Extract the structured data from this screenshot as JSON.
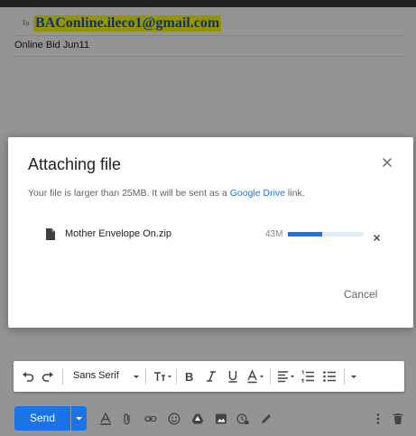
{
  "compose": {
    "to_label": "To",
    "to_value": "BAConline.ileco1@gmail.com",
    "subject": "Online Bid Jun11"
  },
  "dialog": {
    "title": "Attaching file",
    "message_prefix": "Your file is larger than 25MB. It will be sent as a ",
    "message_link": "Google Drive",
    "message_suffix": " link.",
    "file": {
      "name": "Mother Envelope On.zip",
      "size": "43M",
      "progress_percent": 45
    },
    "cancel_label": "Cancel"
  },
  "toolbar": {
    "font": "Sans Serif"
  },
  "bottom": {
    "send_label": "Send"
  },
  "colors": {
    "accent": "#1a73e8",
    "highlight": "#ffff00"
  }
}
